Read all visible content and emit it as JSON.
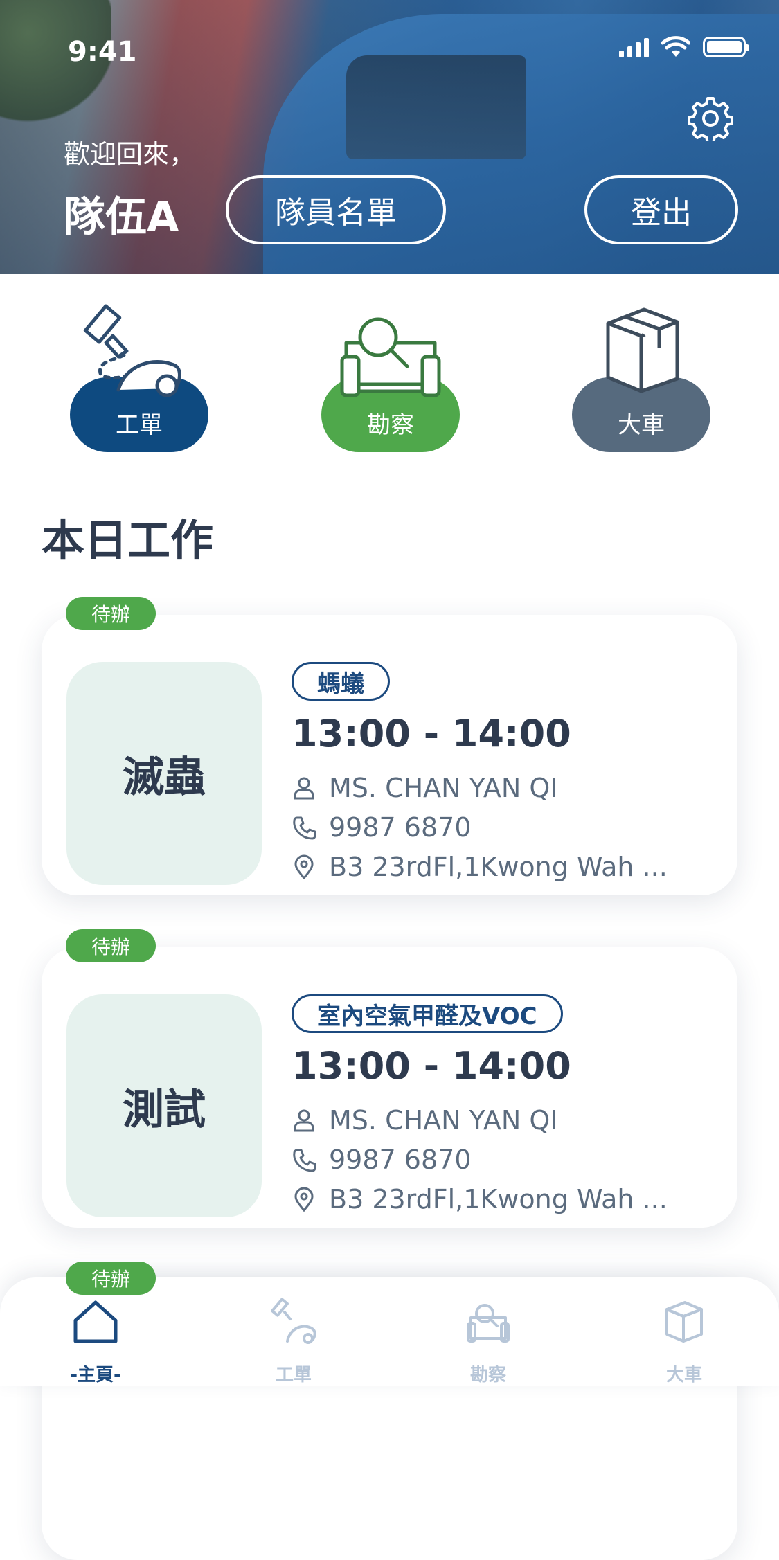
{
  "status_bar": {
    "time": "9:41"
  },
  "header": {
    "welcome": "歡迎回來，",
    "team_name": "隊伍A",
    "roster_button": "隊員名單",
    "logout_button": "登出"
  },
  "quick_actions": [
    {
      "label": "工單",
      "color": "#0e4a80",
      "icon": "spray-bug-icon"
    },
    {
      "label": "勘察",
      "color": "#4fa84b",
      "icon": "inspection-icon"
    },
    {
      "label": "大車",
      "color": "#566a7e",
      "icon": "box-icon"
    }
  ],
  "today": {
    "title": "本日工作",
    "jobs": [
      {
        "status": "待辦",
        "category": "滅蟲",
        "tag": "螞蟻",
        "time": "13:00 - 14:00",
        "contact": "MS. CHAN YAN QI",
        "phone": "9987 6870",
        "address": "B3 23rdFl,1Kwong Wah ..."
      },
      {
        "status": "待辦",
        "category": "測試",
        "tag": "室內空氣甲醛及VOC",
        "time": "13:00 - 14:00",
        "contact": "MS. CHAN YAN QI",
        "phone": "9987 6870",
        "address": "B3 23rdFl,1Kwong Wah ..."
      },
      {
        "status": "待辦"
      }
    ]
  },
  "bottom_nav": [
    {
      "label": "-主頁-",
      "active": true,
      "icon": "home-icon"
    },
    {
      "label": "工單",
      "active": false,
      "icon": "spray-bug-icon"
    },
    {
      "label": "勘察",
      "active": false,
      "icon": "inspection-icon"
    },
    {
      "label": "大車",
      "active": false,
      "icon": "box-icon"
    }
  ]
}
